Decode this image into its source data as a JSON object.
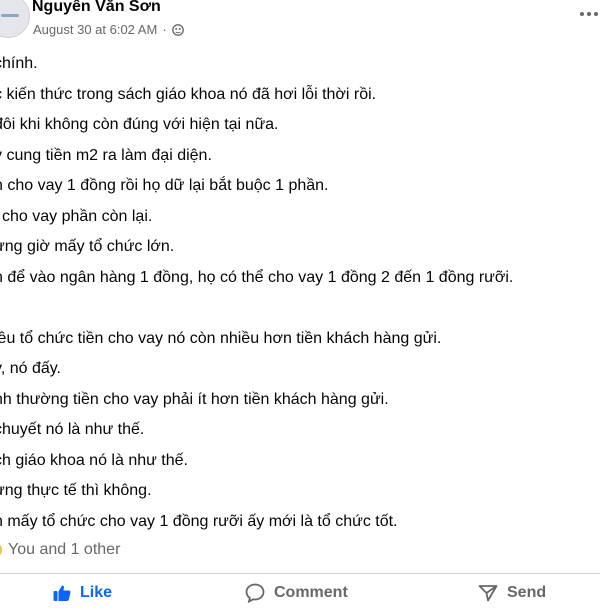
{
  "post": {
    "author": "Nguyễn Văn Sơn",
    "timestamp": "August 30 at 6:02 AM",
    "separator": "·",
    "audience_icon": "friends-icon",
    "more_icon": "more-options-icon",
    "lines": [
      "chính.",
      "c kiến thức trong sách giáo khoa nó đã hơi lỗi thời rồi.",
      "đôi khi không còn đúng với hiện tại nữa.",
      "y cung tiền m2 ra làm đại diện.",
      "n cho vay 1 đồng rồi họ dữ lại bắt buộc 1 phần.",
      "i cho vay phần còn lại.",
      "ưng giờ mấy tổ chức lớn.",
      "n để vào ngân hàng 1 đồng, họ có thể cho vay 1 đồng 2 đến 1 đồng rưỡi.",
      "",
      "iều tổ chức tiền cho vay nó còn nhiều hơn tiền khách hàng gửi.",
      "y, nó đấy.",
      "nh thường tiền cho vay phải ít hơn tiền khách hàng gửi.",
      "chuyết nó là như thế.",
      "ch giáo khoa nó là như thế.",
      "ưng thực tế thì không.",
      "n mấy tổ chức cho vay 1 đồng rưỡi ấy mới là tổ chức tốt."
    ]
  },
  "reactions": {
    "summary": "You and 1 other",
    "icon": "reaction-icon"
  },
  "actions": {
    "like_label": "Like",
    "comment_label": "Comment",
    "send_label": "Send",
    "like_color": "#0866ff"
  },
  "colors": {
    "text": "#050505",
    "secondary": "#65676b",
    "divider": "#ced0d4"
  }
}
